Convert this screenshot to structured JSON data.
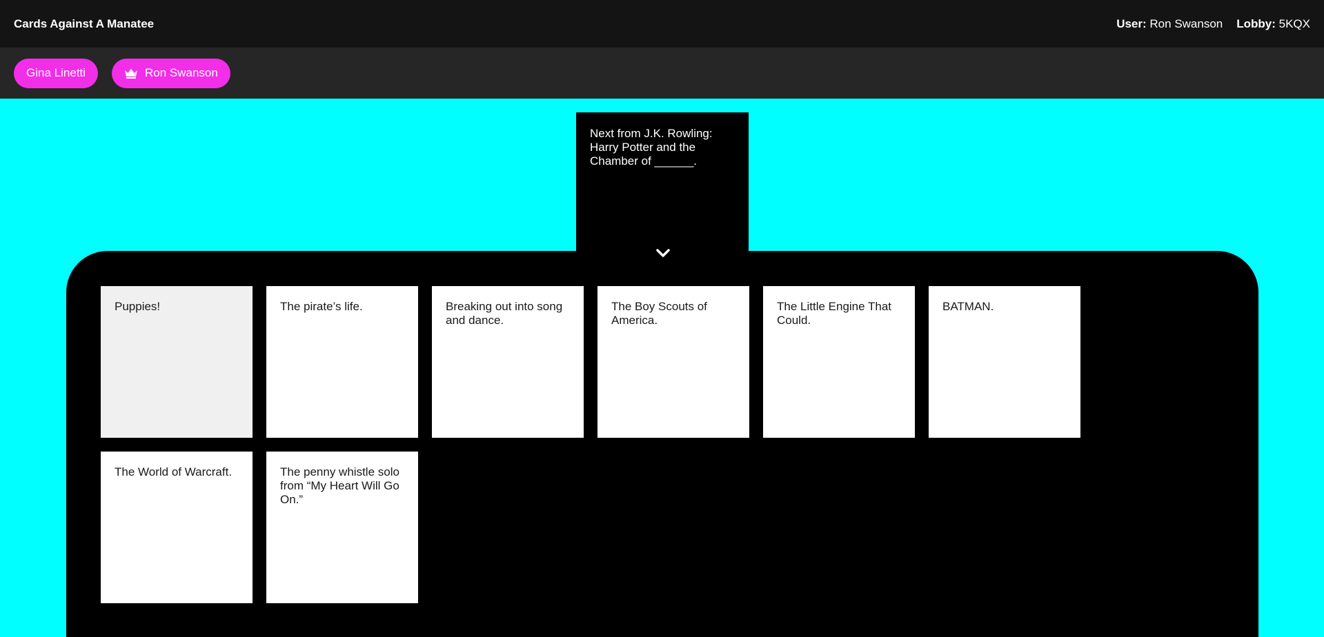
{
  "header": {
    "app_title": "Cards Against A Manatee",
    "user_label": "User:",
    "user_value": "Ron Swanson",
    "lobby_label": "Lobby:",
    "lobby_value": "5KQX"
  },
  "players": [
    {
      "name": "Gina Linetti",
      "is_czar": false
    },
    {
      "name": "Ron Swanson",
      "is_czar": true,
      "icon": "crown-icon"
    }
  ],
  "prompt_card": {
    "text": "Next from J.K. Rowling: Harry Potter and the Chamber of ______."
  },
  "hand": {
    "cards": [
      {
        "text": "Puppies!"
      },
      {
        "text": "The pirate’s life."
      },
      {
        "text": "Breaking out into song and dance."
      },
      {
        "text": "The Boy Scouts of America."
      },
      {
        "text": "The Little Engine That Could."
      },
      {
        "text": "BATMAN."
      },
      {
        "text": "The World of Warcraft."
      },
      {
        "text": "The penny whistle solo from “My Heart Will Go On.”"
      }
    ]
  },
  "colors": {
    "background": "#00ffff",
    "accent": "#f22ee8",
    "topbar": "#141414",
    "playerbar": "#262626"
  }
}
